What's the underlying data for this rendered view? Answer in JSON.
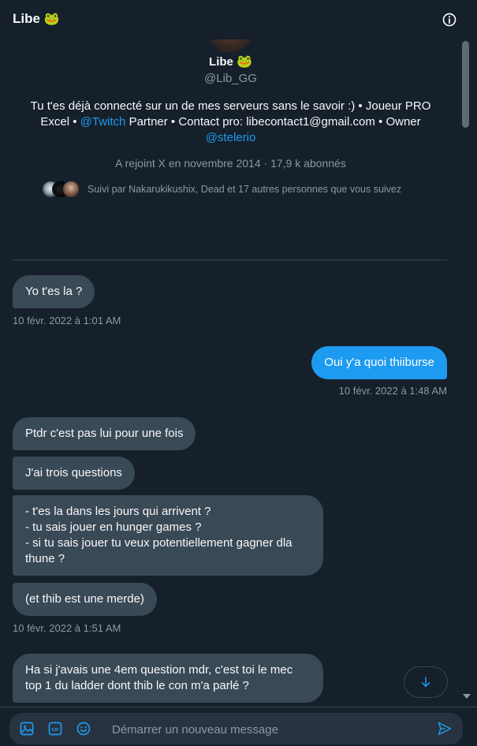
{
  "header": {
    "title": "Libe",
    "title_emoji": "🐸",
    "info_icon": "info-icon"
  },
  "profile": {
    "avatar": "avatar-image",
    "name": "Libe",
    "name_emoji": "🐸",
    "handle": "@Lib_GG",
    "bio": {
      "part1": "Tu t'es déjà connecté sur un de mes serveurs sans le savoir :) • Joueur PRO Excel • ",
      "link1": "@Twitch",
      "part2": " Partner • Contact pro: libecontact1@gmail.com • Owner ",
      "link2": "@stelerio"
    },
    "joined": "A rejoint X en novembre 2014 · 17,9 k abonnés",
    "followed_by": "Suivi par Nakarukikushix, Dead et 17 autres personnes que vous suivez"
  },
  "messages": [
    {
      "text": "Yo t'es la ?"
    },
    {
      "timestamp": "10 févr. 2022 à 1:01 AM"
    },
    {
      "text": "Oui y'a quoi thiiburse"
    },
    {
      "timestamp": "10 févr. 2022 à 1:48 AM"
    },
    {
      "text": "Ptdr c'est pas lui pour une fois"
    },
    {
      "text": "J'ai trois questions"
    },
    {
      "lines": [
        "- t'es la dans les jours qui arrivent ?",
        "- tu sais jouer en hunger games ?",
        "- si tu sais jouer tu veux potentiellement gagner dla thune ?"
      ]
    },
    {
      "text": "(et thib est une merde)"
    },
    {
      "timestamp": "10 févr. 2022 à 1:51 AM"
    },
    {
      "text": "Ha si j'avais une 4em question mdr, c'est toi le mec top 1 du ladder dont thib le con m'a parlé ?"
    }
  ],
  "jump_to_bottom_icon": "arrow-down-icon",
  "composer": {
    "placeholder": "Démarrer un nouveau message",
    "icons": [
      "image-icon",
      "gif-icon",
      "emoji-icon",
      "send-icon"
    ]
  },
  "colors": {
    "background": "#15202b",
    "incoming_bubble": "#3a4956",
    "outgoing_bubble": "#1d9bf0",
    "accent": "#1d9bf0",
    "muted_text": "#8b98a5"
  }
}
